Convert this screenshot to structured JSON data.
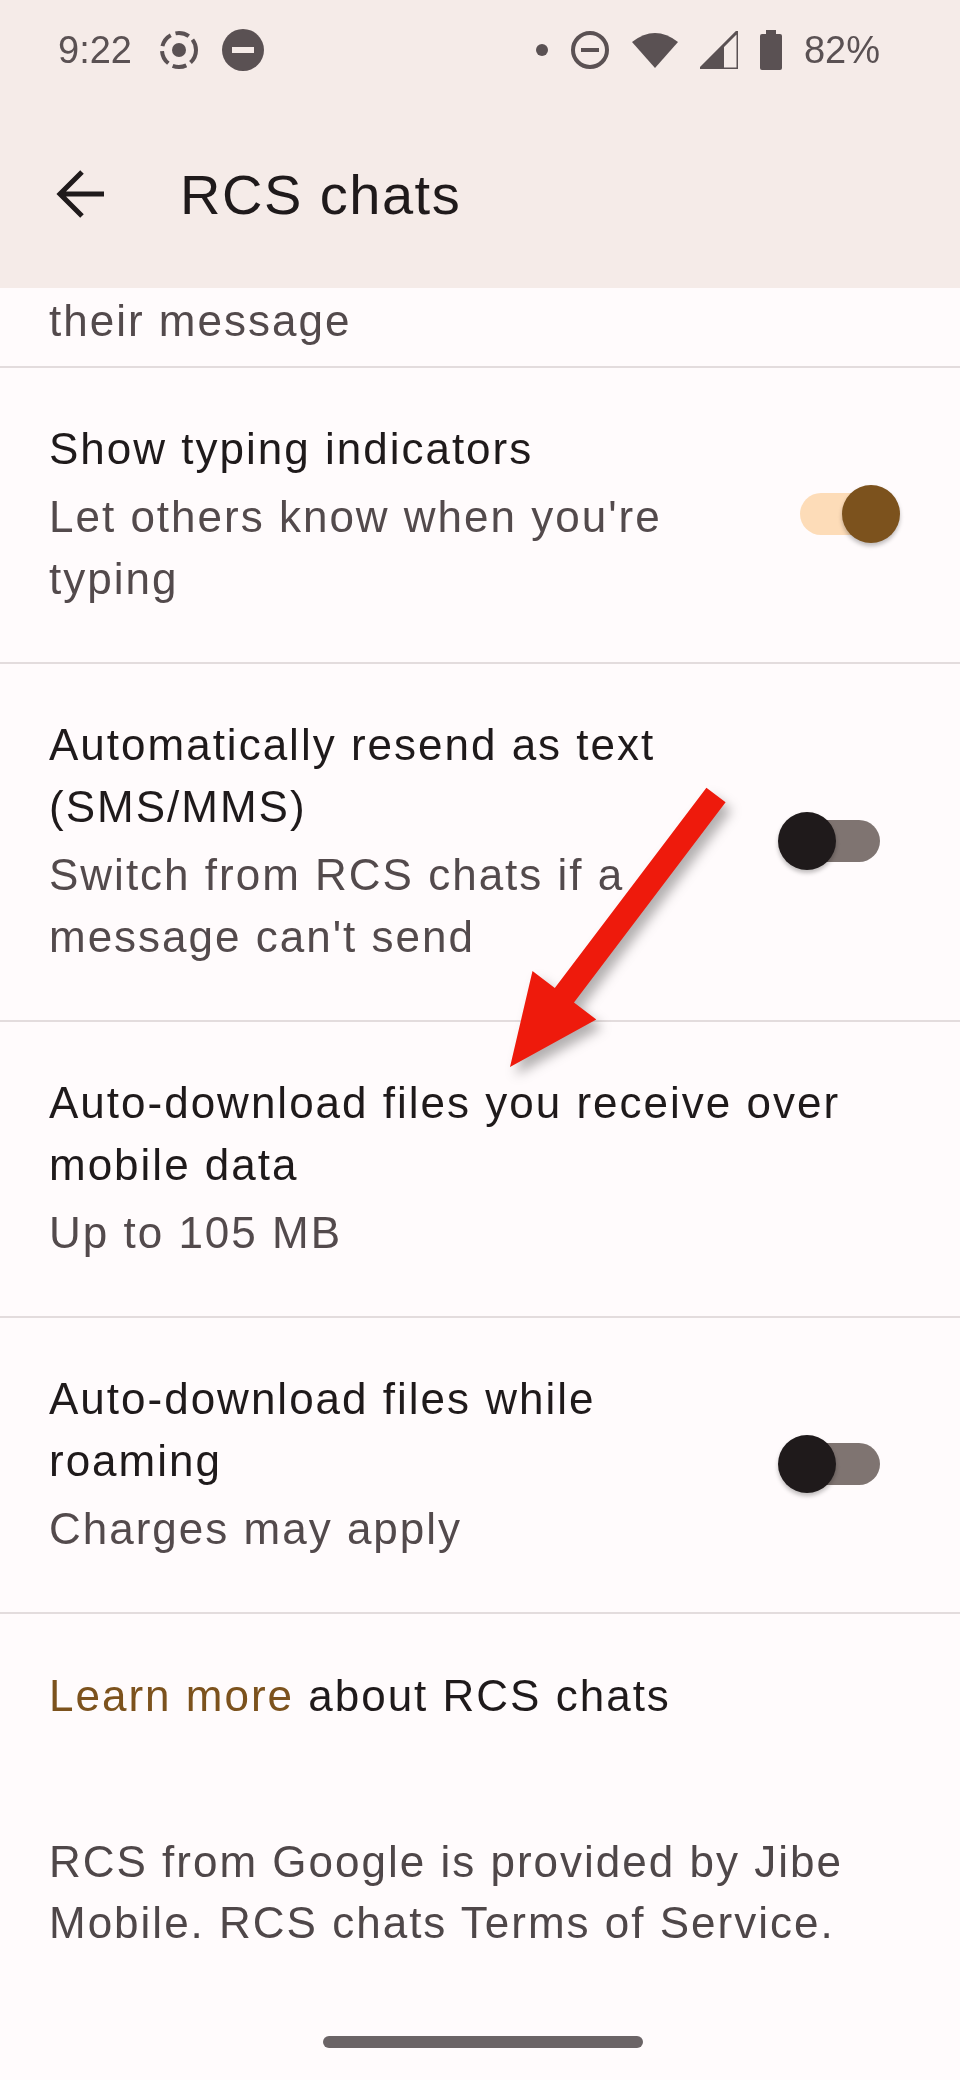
{
  "status_bar": {
    "time": "9:22",
    "battery": "82%"
  },
  "app_bar": {
    "title": "RCS chats"
  },
  "settings": [
    {
      "kind": "fragment",
      "subtitle": "their message"
    },
    {
      "kind": "toggle",
      "title": "Show typing indicators",
      "subtitle": "Let others know when you're typing",
      "on": true
    },
    {
      "kind": "toggle",
      "title": "Automatically resend as text (SMS/MMS)",
      "subtitle": "Switch from RCS chats if a message can't send",
      "on": false
    },
    {
      "kind": "plain",
      "title": "Auto-download files you receive over mobile data",
      "subtitle": "Up to 105 MB"
    },
    {
      "kind": "toggle",
      "title": "Auto-download files while roaming",
      "subtitle": "Charges may apply",
      "on": false
    }
  ],
  "footer": {
    "link": "Learn more",
    "link_rest": "about RCS chats",
    "legal": "RCS from Google is provided by Jibe Mobile. RCS chats Terms of Service."
  },
  "annotations": [
    {
      "kind": "arrow"
    }
  ]
}
